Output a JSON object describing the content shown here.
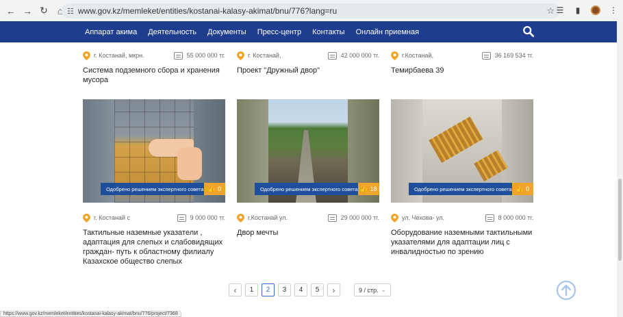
{
  "browser": {
    "url": "www.gov.kz/memleket/entities/kostanai-kalasy-akimat/bnu/776?lang=ru",
    "status_url": "https://www.gov.kz/memleket/entities/kostanai-kalasy-akimat/bnu/776/project/7368"
  },
  "nav": {
    "items": [
      "Аппарат акима",
      "Деятельность",
      "Документы",
      "Пресс-центр",
      "Контакты",
      "Онлайн приемная"
    ]
  },
  "top_cards": [
    {
      "location": "г. Костанай, мкрн.",
      "price": "55 000 000 тг.",
      "title": "Система подземного сбора и хранения мусора"
    },
    {
      "location": "г. Костанай,",
      "price": "42 000 000 тг.",
      "title": "Проект \"Дружный двор\""
    },
    {
      "location": "г.Костанай,",
      "price": "36 169 534 тг.",
      "title": "Темирбаева 39"
    }
  ],
  "cards": [
    {
      "badge": "Одобрено решением экспертного совета",
      "likes": "0",
      "location": "г. Костанай с",
      "price": "9 000 000 тг.",
      "title": "Тактильные наземные указатели , адаптация для слепых и слабовидящих граждан- путь к областному филиалу Казахское общество слепых"
    },
    {
      "badge": "Одобрено решением экспертного совета",
      "likes": "18",
      "location": "г.Костанай ул.",
      "price": "29 000 000 тг.",
      "title": "Двор мечты"
    },
    {
      "badge": "Одобрено решением экспертного совета",
      "likes": "0",
      "location": "ул. Чехова- ул.",
      "price": "8 000 000 тг.",
      "title": "Оборудование наземными тактильными указателями для адаптации лиц с инвалидностью по зрению"
    }
  ],
  "pagination": {
    "pages": [
      "1",
      "2",
      "3",
      "4",
      "5"
    ],
    "active": "2",
    "per_page": "9 / стр."
  },
  "colors": {
    "nav_bg": "#1e3d8f",
    "badge_bg": "#1f4e9c",
    "likes_bg": "#f0a52a",
    "pin": "#f0a52a",
    "active_page": "#2f6bd3"
  }
}
